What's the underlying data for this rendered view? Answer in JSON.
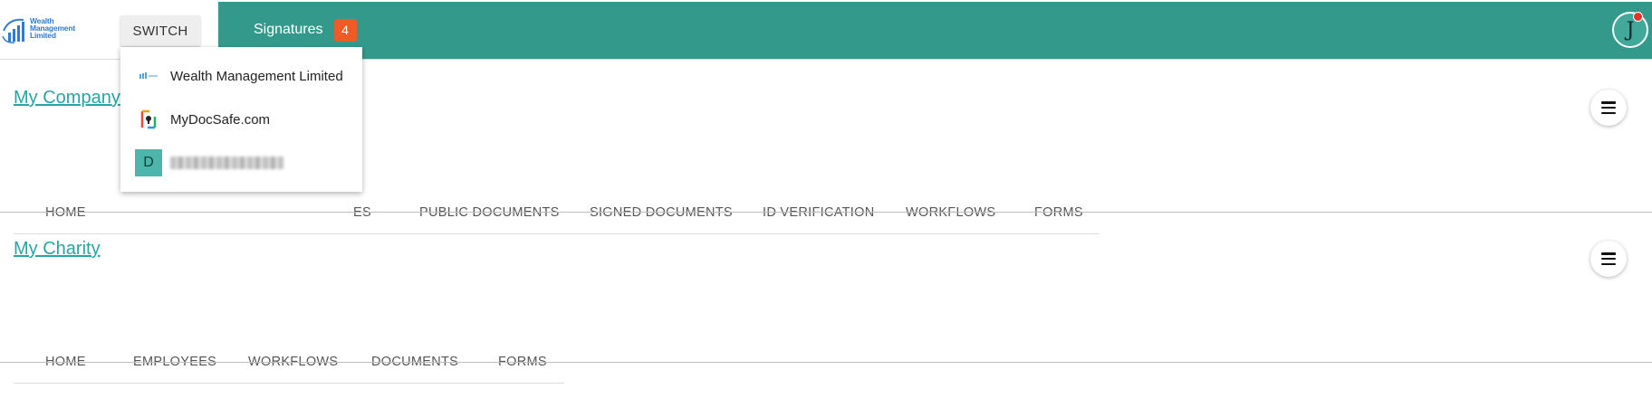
{
  "header": {
    "logo_text": "Wealth\nManagement\nLimited",
    "switch_label": "SWITCH",
    "signatures_label": "Signatures",
    "signatures_count": "4",
    "avatar_initial": "J",
    "accent_color": "#339a8b",
    "badge_color": "#f15a24"
  },
  "switch_menu": {
    "items": [
      {
        "label": "Wealth Management Limited",
        "icon": "company-logo-icon"
      },
      {
        "label": "MyDocSafe.com",
        "icon": "mydocsafe-logo-icon"
      },
      {
        "letter": "D",
        "icon": "org-letter-icon"
      }
    ]
  },
  "orgs": [
    {
      "name": "My Company",
      "tabs": [
        "HOME",
        "",
        "ES",
        "PUBLIC DOCUMENTS",
        "SIGNED DOCUMENTS",
        "ID VERIFICATION",
        "WORKFLOWS",
        "FORMS"
      ]
    },
    {
      "name": "My Charity",
      "tabs": [
        "HOME",
        "EMPLOYEES",
        "WORKFLOWS",
        "DOCUMENTS",
        "FORMS"
      ]
    }
  ]
}
